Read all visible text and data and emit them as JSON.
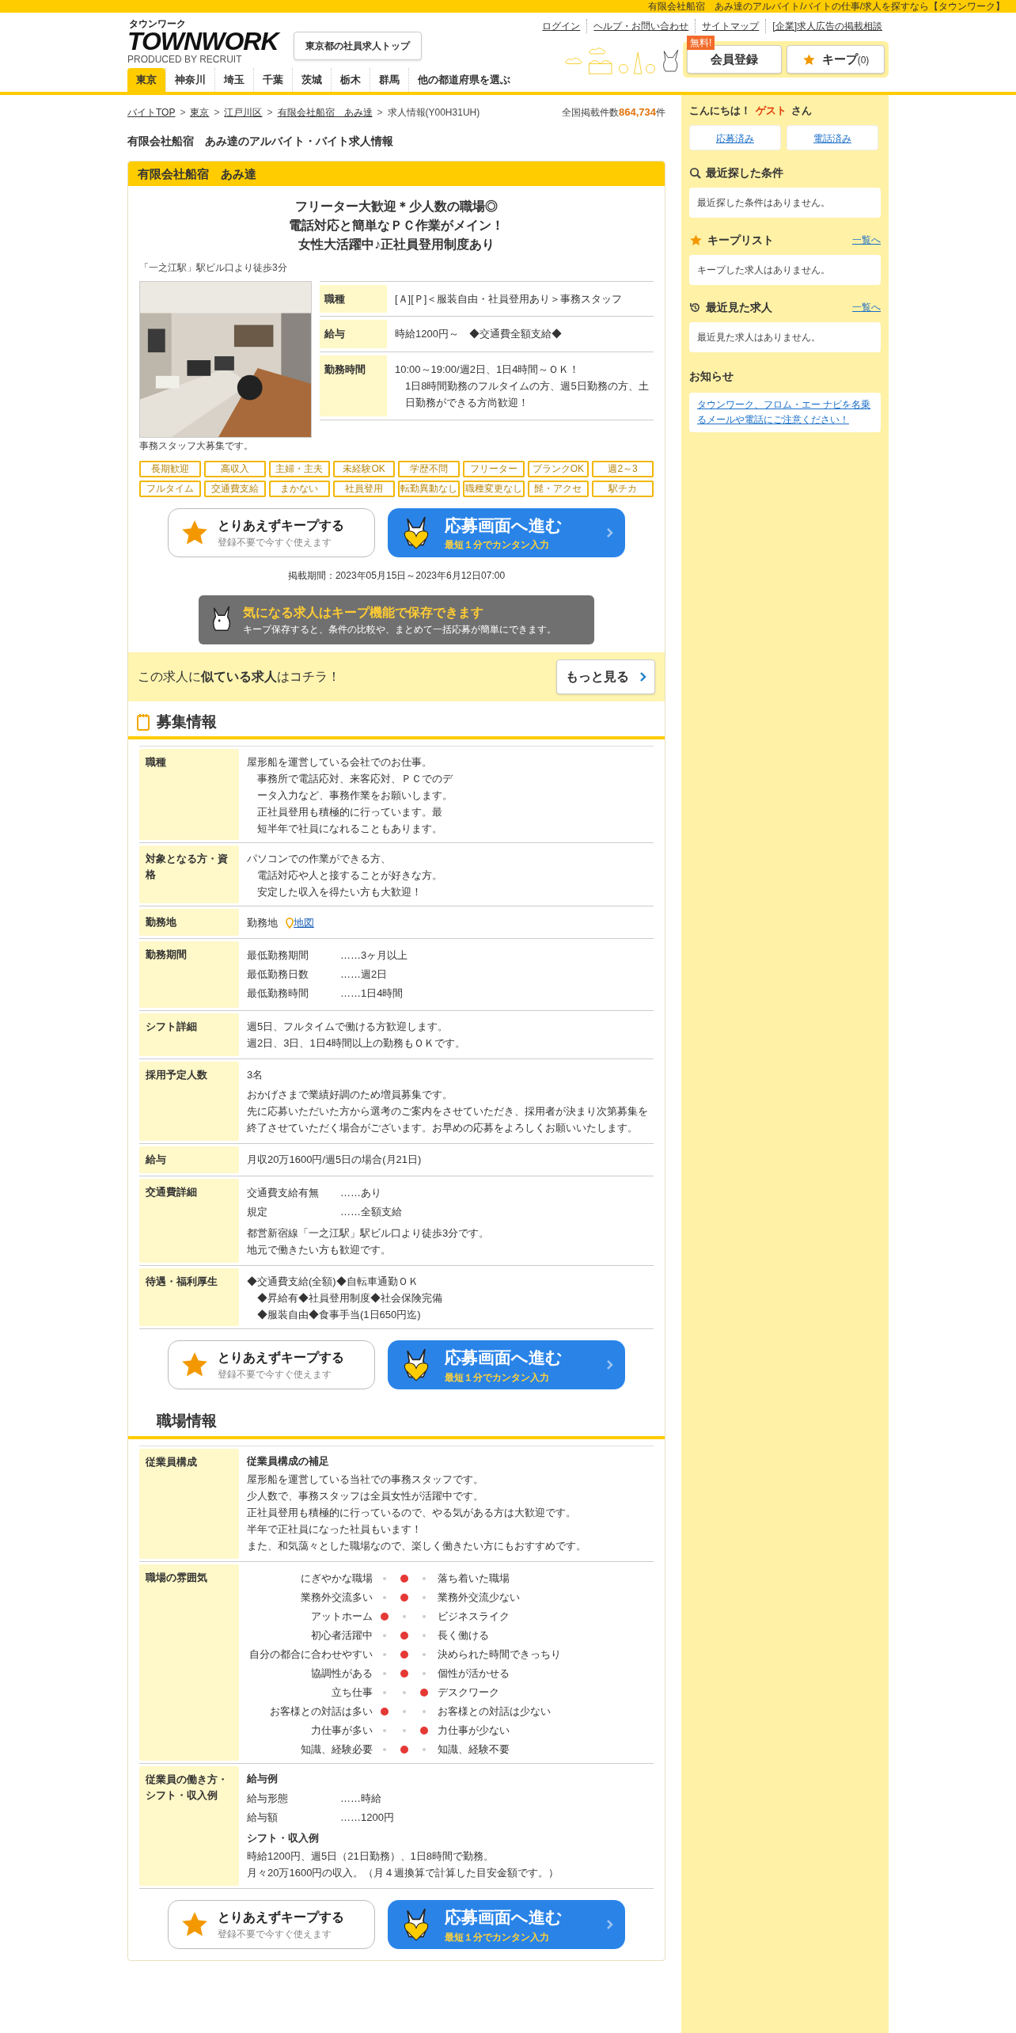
{
  "top_strip": "有限会社船宿　あみ達のアルバイト/バイトの仕事/求人を探すなら【タウンワーク】",
  "logo": {
    "kana": "タウンワーク",
    "word": "TOWNWORK",
    "credit": "PRODUCED BY RECRUIT"
  },
  "top_button": "東京都の社員求人トップ",
  "header_links": [
    "ログイン",
    "ヘルプ・お問い合わせ",
    "サイトマップ",
    "[企業]求人広告の掲載相談"
  ],
  "register": {
    "label": "会員登録",
    "badge": "無料!"
  },
  "keep": {
    "label": "キープ",
    "count": "(0)"
  },
  "tabs": [
    {
      "label": "東京",
      "selected": true
    },
    {
      "label": "神奈川",
      "selected": false
    },
    {
      "label": "埼玉",
      "selected": false
    },
    {
      "label": "千葉",
      "selected": false
    },
    {
      "label": "茨城",
      "selected": false
    },
    {
      "label": "栃木",
      "selected": false
    },
    {
      "label": "群馬",
      "selected": false
    },
    {
      "label": "他の都道府県を選ぶ",
      "selected": false
    }
  ],
  "breadcrumb": [
    {
      "label": "バイトTOP",
      "link": true
    },
    {
      "separator": ">",
      "label": "東京",
      "link": true
    },
    {
      "separator": ">",
      "label": "江戸川区",
      "link": true
    },
    {
      "separator": ">",
      "label": "有限会社船宿　あみ達",
      "link": true
    },
    {
      "separator": ">",
      "label": "求人情報(Y00H31UH)",
      "link": false
    }
  ],
  "total": {
    "label": "全国掲載件数",
    "count": "864,734",
    "unit": "件"
  },
  "page_title": "有限会社船宿　あみ達のアルバイト・バイト求人情報",
  "company": "有限会社船宿　あみ達",
  "catch_lines": [
    "フリーター大歓迎＊少人数の職場◎",
    "電話対応と簡単なＰＣ作業がメイン！",
    "女性大活躍中♪正社員登用制度あり"
  ],
  "access": "「一之江駅」駅ビル口より徒歩3分",
  "photo_caption": "事務スタッフ大募集です。",
  "summary": [
    {
      "label": "職種",
      "lines": [
        "[Ａ][Ｐ]＜服装自由・社員登用あり＞事務スタッフ"
      ]
    },
    {
      "label": "給与",
      "lines": [
        "時給1200円～　◆交通費全額支給◆"
      ]
    },
    {
      "label": "勤務時間",
      "lines": [
        "10:00～19:00/週2日、1日4時間～ＯＫ！",
        "1日8時間勤務のフルタイムの方、週5日勤務の方、土日勤務ができる方尚歓迎！"
      ]
    }
  ],
  "tags": [
    "長期歓迎",
    "高収入",
    "主婦・主夫",
    "未経験OK",
    "学歴不問",
    "フリーター",
    "ブランクOK",
    "週2～3",
    "フルタイム",
    "交通費支給",
    "まかない",
    "社員登用",
    "転勤異動なし",
    "職種変更なし",
    "髭・アクセ",
    "駅チカ"
  ],
  "actions_top": {
    "keep_title": "とりあえずキープする",
    "keep_sub": "登録不要で今すぐ使えます",
    "apply_title": "応募画面へ進む",
    "apply_sub": "最短１分でカンタン入力"
  },
  "period": "掲載期間：2023年05月15日～2023年6月12日07:00",
  "keep_banner": {
    "title": "気になる求人はキープ機能で保存できます",
    "text": "キープ保存すると、条件の比較や、まとめて一括応募が簡単にできます。"
  },
  "similar": {
    "text": "この求人に**似ている求人**はコチラ！",
    "button": "もっと見る"
  },
  "recruit_heading": "募集情報",
  "recruit_rows": [
    {
      "label": "職種",
      "blocks": [
        {
          "kind": "hanging",
          "lines": [
            "屋形船を運営している会社でのお仕事。",
            "事務所で電話応対、来客応対、ＰＣでのデ",
            "ータ入力など、事務作業をお願いします。",
            "正社員登用も積極的に行っています。最",
            "短半年で社員になれることもあります。"
          ]
        }
      ]
    },
    {
      "label": "対象となる方・資格",
      "blocks": [
        {
          "kind": "hanging",
          "lines": [
            "パソコンでの作業ができる方、",
            "電話対応や人と接することが好きな方。",
            "安定した収入を得たい方も大歓迎！"
          ]
        }
      ]
    },
    {
      "label": "勤務地",
      "blocks": [
        {
          "kind": "location",
          "text": "勤務地",
          "link": "地図"
        }
      ]
    },
    {
      "label": "勤務期間",
      "blocks": [
        {
          "kind": "pairs",
          "items": [
            {
              "key": "最低勤務期間",
              "value": "……3ヶ月以上"
            },
            {
              "key": "最低勤務日数",
              "value": "……週2日"
            },
            {
              "key": "最低勤務時間",
              "value": "……1日4時間"
            }
          ]
        }
      ]
    },
    {
      "label": "シフト詳細",
      "blocks": [
        {
          "kind": "para",
          "lines": [
            "週5日、フルタイムで働ける方歓迎します。",
            "週2日、3日、1日4時間以上の勤務もＯＫです。"
          ]
        }
      ]
    },
    {
      "label": "採用予定人数",
      "blocks": [
        {
          "kind": "para",
          "lines": [
            "3名"
          ]
        },
        {
          "kind": "para",
          "lines": [
            "おかげさまで業績好調のため増員募集です。",
            "先に応募いただいた方から選考のご案内をさせていただき、採用者が決まり次第募集を終了させていただく場合がございます。お早めの応募をよろしくお願いいたします。"
          ]
        }
      ]
    },
    {
      "label": "給与",
      "blocks": [
        {
          "kind": "para",
          "lines": [
            "月収20万1600円/週5日の場合(月21日)"
          ]
        }
      ]
    },
    {
      "label": "交通費詳細",
      "blocks": [
        {
          "kind": "pairs",
          "items": [
            {
              "key": "交通費支給有無",
              "value": "……あり"
            },
            {
              "key": "規定",
              "value": "……全額支給"
            }
          ]
        },
        {
          "kind": "para",
          "lines": [
            "都営新宿線「一之江駅」駅ビル口より徒歩3分です。",
            "地元で働きたい方も歓迎です。"
          ]
        }
      ]
    },
    {
      "label": "待遇・福利厚生",
      "blocks": [
        {
          "kind": "hanging",
          "lines": [
            "◆交通費支給(全額)◆自転車通勤ＯＫ",
            "◆昇給有◆社員登用制度◆社会保険完備",
            "◆服装自由◆食事手当(1日650円迄)"
          ]
        }
      ]
    }
  ],
  "actions_middle": {
    "keep_title": "とりあえずキープする",
    "keep_sub": "登録不要で今すぐ使えます",
    "apply_title": "応募画面へ進む",
    "apply_sub": "最短１分でカンタン入力"
  },
  "workplace_heading": "職場情報",
  "workplace_rows": [
    {
      "label": "従業員構成",
      "blocks": [
        {
          "kind": "heading",
          "text": "従業員構成の補足"
        },
        {
          "kind": "para",
          "lines": [
            "屋形船を運営している当社での事務スタッフです。",
            "少人数で、事務スタッフは全員女性が活躍中です。",
            "正社員登用も積極的に行っているので、やる気がある方は大歓迎です。",
            "半年で正社員になった社員もいます！",
            "また、和気藹々とした職場なので、楽しく働きたい方にもおすすめです。"
          ]
        }
      ]
    },
    {
      "label": "職場の雰囲気",
      "blocks": [
        {
          "kind": "mood",
          "rows": [
            {
              "left": "にぎやかな職場",
              "right": "落ち着いた職場",
              "level": 0.5
            },
            {
              "left": "業務外交流多い",
              "right": "業務外交流少ない",
              "level": 0.5
            },
            {
              "left": "アットホーム",
              "right": "ビジネスライク",
              "level": 0
            },
            {
              "left": "初心者活躍中",
              "right": "長く働ける",
              "level": 0.5
            },
            {
              "left": "自分の都合に合わせやすい",
              "right": "決められた時間できっちり",
              "level": 0.5
            },
            {
              "left": "協調性がある",
              "right": "個性が活かせる",
              "level": 0.5
            },
            {
              "left": "立ち仕事",
              "right": "デスクワーク",
              "level": 1
            },
            {
              "left": "お客様との対話は多い",
              "right": "お客様との対話は少ない",
              "level": 0
            },
            {
              "left": "力仕事が多い",
              "right": "力仕事が少ない",
              "level": 1
            },
            {
              "left": "知識、経験必要",
              "right": "知識、経験不要",
              "level": 0.5
            }
          ]
        }
      ]
    },
    {
      "label": "従業員の働き方・シフト・収入例",
      "blocks": [
        {
          "kind": "heading",
          "text": "給与例"
        },
        {
          "kind": "pairs",
          "items": [
            {
              "key": "給与形態",
              "value": "……時給"
            },
            {
              "key": "給与額",
              "value": "……1200円"
            }
          ]
        },
        {
          "kind": "heading",
          "text": "シフト・収入例"
        },
        {
          "kind": "para",
          "lines": [
            "時給1200円、週5日（21日勤務）、1日8時間で勤務。",
            "月々20万1600円の収入。（月４週換算で計算した目安金額です。）"
          ]
        }
      ]
    }
  ],
  "actions_bottom": {
    "keep_title": "とりあえずキープする",
    "keep_sub": "登録不要で今すぐ使えます",
    "apply_title": "応募画面へ進む",
    "apply_sub": "最短１分でカンタン入力"
  },
  "sidebar": {
    "greeting": "こんにちは！",
    "guest": "ゲスト",
    "suffix": "さん",
    "buttons": [
      "応募済み",
      "電話済み"
    ],
    "sections": [
      {
        "title": "最近探した条件",
        "empty": "最近探した条件はありません。"
      },
      {
        "title": "キープリスト",
        "link": "一覧へ",
        "empty": "キープした求人はありません。"
      },
      {
        "title": "最近見た求人",
        "link": "一覧へ",
        "empty": "最近見た求人はありません。"
      }
    ],
    "notice_title": "お知らせ",
    "notice_link": "タウンワーク、フロム・エー ナビを名乗るメールや電話にご注意ください！"
  }
}
